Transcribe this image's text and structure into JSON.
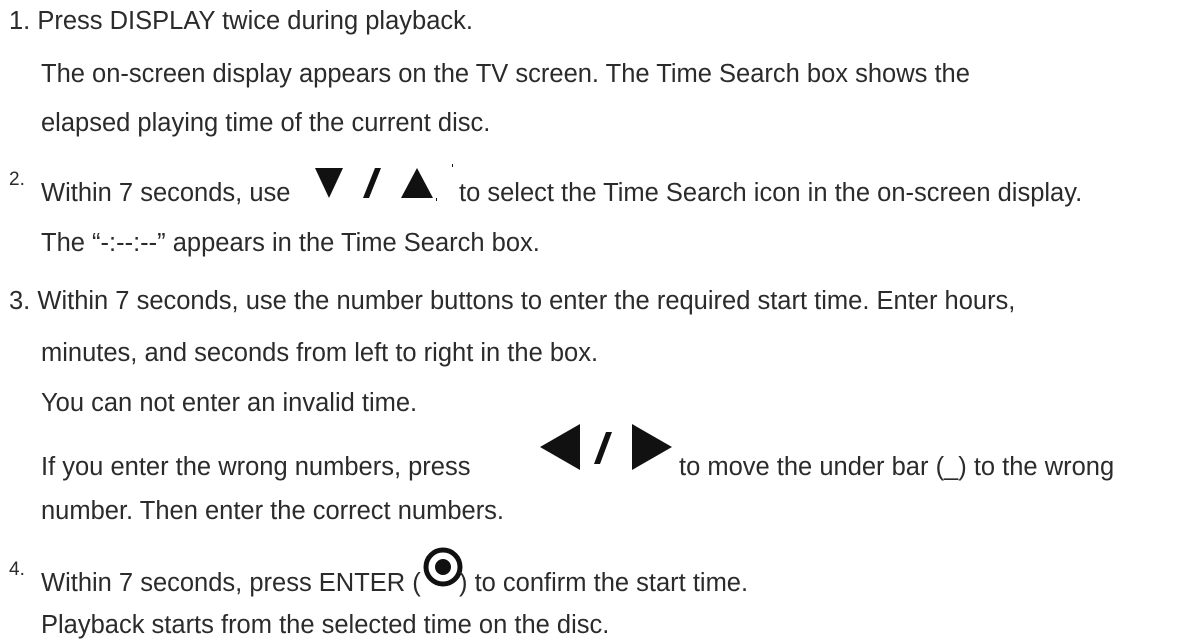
{
  "steps": [
    {
      "number": "1.",
      "lines": [
        "Press DISPLAY twice during playback.",
        "The on-screen display appears on the TV screen. The Time Search box shows the",
        "elapsed playing time of the current disc."
      ]
    },
    {
      "number": "2.",
      "line1_before": "Within 7 seconds, use",
      "line1_after": "to select the Time Search icon in the on-screen display.",
      "icon": "down-up-arrows-icon",
      "line2": "The “-:--:--” appears in the Time Search box."
    },
    {
      "number": "3.",
      "lines": [
        "Within 7 seconds, use the number buttons to enter the required start time. Enter hours,",
        "minutes, and seconds from left to right in the box.",
        "You can not enter an invalid time."
      ],
      "wrong_before": "If you enter the wrong numbers, press",
      "wrong_after": "to move the under bar (_) to the wrong",
      "wrong_icon": "left-right-arrows-icon",
      "wrong_line2": "number. Then enter the correct numbers."
    },
    {
      "number": "4.",
      "line1_before": "Within 7 seconds, press ENTER (",
      "line1_after": ") to confirm the start time.",
      "icon": "enter-button-icon",
      "line2": "Playback starts from the selected time on the disc."
    }
  ],
  "colors": {
    "text": "#2b2b2b",
    "icon": "#111111"
  }
}
